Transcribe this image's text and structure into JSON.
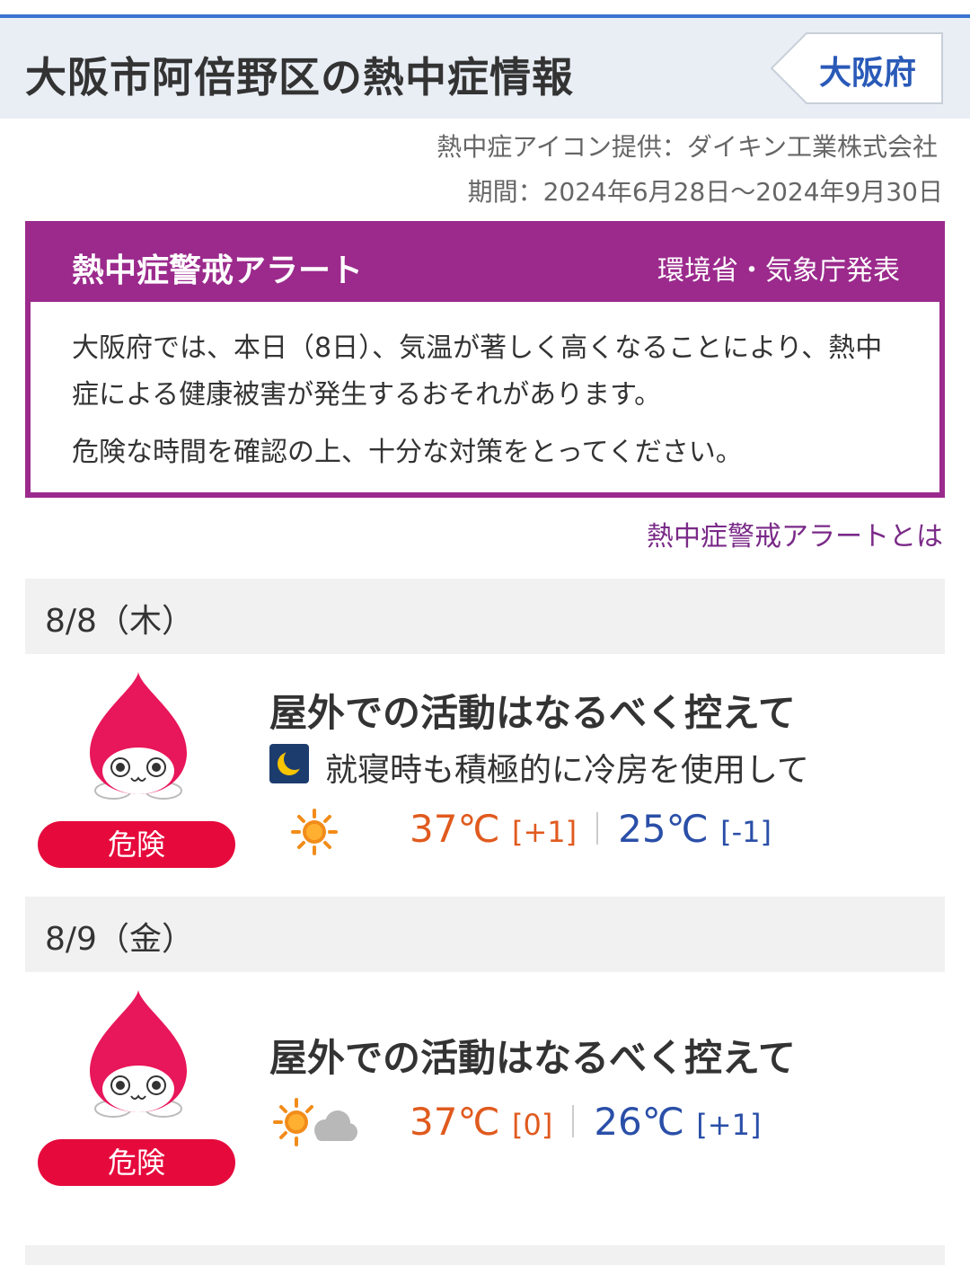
{
  "header": {
    "title": "大阪市阿倍野区の熱中症情報",
    "prefecture_button": "大阪府"
  },
  "credit": "熱中症アイコン提供：ダイキン工業株式会社",
  "period": "期間：2024年6月28日〜2024年9月30日",
  "alert": {
    "title": "熱中症警戒アラート",
    "source": "環境省・気象庁発表",
    "body_line1": "大阪府では、本日（8日）、気温が著しく高くなることにより、熱中症による健康被害が発生するおそれがあります。",
    "body_line2": "危険な時間を確認の上、十分な対策をとってください。",
    "link": "熱中症警戒アラートとは"
  },
  "days": [
    {
      "date": "8/8（木）",
      "badge": "危険",
      "advice": "屋外での活動はなるべく控えて",
      "night_advice": "就寝時も積極的に冷房を使用して",
      "weather_icon": "sun-icon",
      "max_temp": "37℃",
      "max_diff": "[+1]",
      "min_temp": "25℃",
      "min_diff": "[-1]"
    },
    {
      "date": "8/9（金）",
      "badge": "危険",
      "advice": "屋外での活動はなるべく控えて",
      "weather_icon": "sun-cloud-icon",
      "max_temp": "37℃",
      "max_diff": "[0]",
      "min_temp": "26℃",
      "min_diff": "[+1]"
    }
  ],
  "colors": {
    "header_bg": "#e9eef5",
    "header_top_border": "#3a73d0",
    "alert_purple": "#9b2a8c",
    "danger_red": "#e60a3c",
    "max_temp": "#e05a1e",
    "min_temp": "#2a4fa8"
  }
}
